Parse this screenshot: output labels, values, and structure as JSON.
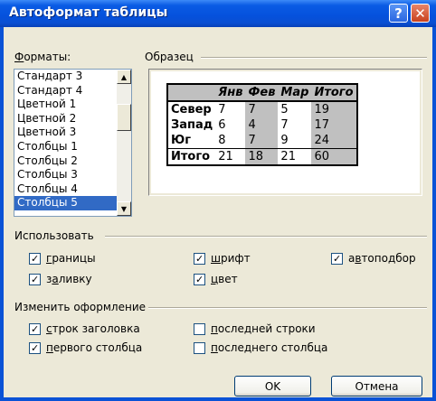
{
  "window": {
    "title": "Автоформат таблицы"
  },
  "titlebar_buttons": {
    "help": "?",
    "close": "✕"
  },
  "formats": {
    "label_pre": "",
    "label_ul": "Ф",
    "label_post": "орматы:",
    "items": [
      "Стандарт 3",
      "Стандарт 4",
      "Цветной 1",
      "Цветной 2",
      "Цветной 3",
      "Столбцы 1",
      "Столбцы 2",
      "Столбцы 3",
      "Столбцы 4",
      "Столбцы 5"
    ],
    "selected": "Столбцы 5"
  },
  "sample": {
    "label": "Образец",
    "header": [
      "",
      "Янв",
      "Фев",
      "Мар",
      "Итого"
    ],
    "rows": [
      [
        "Север",
        "7",
        "7",
        "5",
        "19"
      ],
      [
        "Запад",
        "6",
        "4",
        "7",
        "17"
      ],
      [
        "Юг",
        "8",
        "7",
        "9",
        "24"
      ],
      [
        "Итого",
        "21",
        "18",
        "21",
        "60"
      ]
    ]
  },
  "use": {
    "label": "Использовать",
    "borders": {
      "ul": "г",
      "rest": "раницы",
      "checked": true
    },
    "font": {
      "ul": "ш",
      "rest": "рифт",
      "checked": true
    },
    "autofit": {
      "pre": "а",
      "ul": "в",
      "rest": "топодбор",
      "checked": true
    },
    "fill": {
      "pre": "з",
      "ul": "а",
      "rest": "ливку",
      "checked": true
    },
    "color": {
      "ul": "ц",
      "rest": "вет",
      "checked": true
    }
  },
  "modify": {
    "label": "Изменить оформление",
    "header_rows": {
      "ul": "с",
      "rest": "трок заголовка",
      "checked": true
    },
    "last_row": {
      "ul": "п",
      "rest": "оследней строки",
      "checked": false
    },
    "first_col": {
      "ul": "п",
      "rest": "ервого столбца",
      "checked": true
    },
    "last_col": {
      "ul": "п",
      "rest": "оследнего столбца",
      "checked": false
    }
  },
  "buttons": {
    "ok": "OK",
    "cancel": "Отмена"
  }
}
